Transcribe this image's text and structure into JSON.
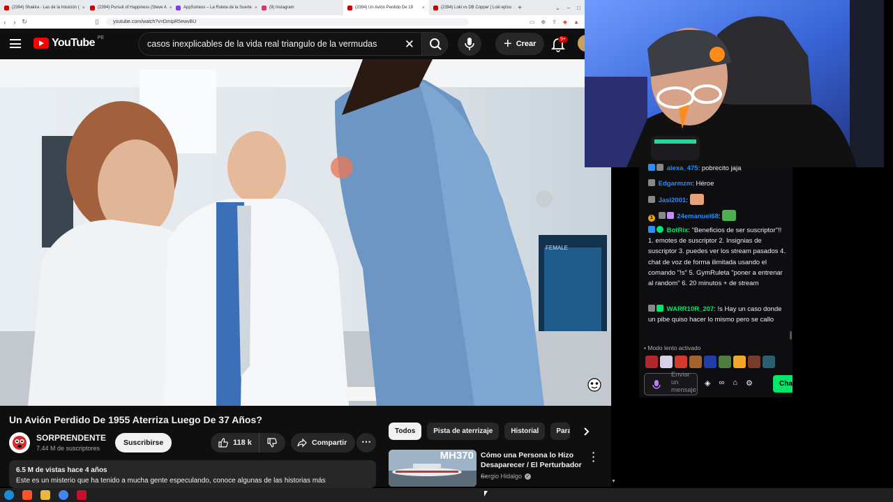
{
  "browser": {
    "tabs": [
      {
        "label": "(2394) Shakira - Las de la Intuición (",
        "color": "#cc0000",
        "active": false
      },
      {
        "label": "(2394) Pursuit of Happiness (Steve A",
        "color": "#cc0000",
        "active": false
      },
      {
        "label": "AppSorteos – La Ruleta de la Suerte",
        "color": "#7b3fe4",
        "active": false
      },
      {
        "label": "(9) Instagram",
        "color": "#e1306c",
        "active": false
      },
      {
        "label": "(2394) Un Avión Perdido De 19",
        "color": "#cc0000",
        "active": true
      },
      {
        "label": "(2394) Loki vs DB Copper | Loki episo",
        "color": "#cc0000",
        "active": false
      }
    ],
    "new_tab": "+",
    "url": "youtube.com/watch?v=DmipR5ewvBU"
  },
  "header": {
    "logo_text": "YouTube",
    "region": "PE",
    "search_query": "casos inexplicables de la vida real triangulo de la vermudas",
    "create_label": "Crear",
    "notif_count": "9+"
  },
  "video": {
    "title": "Un Avión Perdido De 1955 Aterriza Luego De 37 Años?",
    "channel_name": "SORPRENDENTE",
    "subscribers": "7.44 M de suscriptores",
    "subscribe_label": "Suscribirse",
    "likes": "118 k",
    "share_label": "Compartir",
    "stats": "6.5 M de vistas  hace 4 años",
    "description": "Este es un misterio que ha tenido a mucha gente especulando, conoce algunas de las historias más",
    "monitor_label": "FEMALE"
  },
  "chips": [
    "Todos",
    "Pista de aterrizaje",
    "Historial",
    "Para t"
  ],
  "recommended": {
    "thumb_text": "MH370",
    "title": "Cómo una Persona lo Hizo Desaparecer / El Perturbador ...",
    "channel": "Sergio Hidalgo"
  },
  "chat": {
    "messages": [
      {
        "user": "alexa_475",
        "user_color": "#1e90ff",
        "text": "pobrecito jaja"
      },
      {
        "user": "Edgarmzm",
        "user_color": "#1e90ff",
        "text": "Héroe"
      },
      {
        "user": "Jasl2001",
        "user_color": "#1e90ff",
        "text": ""
      },
      {
        "user": "24emanuel68",
        "user_color": "#1e90ff",
        "text": "",
        "badge_num": "1"
      },
      {
        "user": "BotRix",
        "user_color": "#00e66b",
        "text": "\"Beneficios de ser suscriptor\"!! 1. emotes de suscriptor 2. Insignias de suscriptor 3. puedes ver los stream pasados 4. chat de voz de forma ilimitada usando el comando \"!s\" 5. GymRuleta \"poner a entrenar al random\" 6. 20 minutos + de stream"
      },
      {
        "user": "WARR10R_207",
        "user_color": "#00e66b",
        "text": "!s Hay un caso donde un pibe quiso hacer lo mismo pero se callo"
      }
    ],
    "slow_mode": "Modo lento activado",
    "input_placeholder": "Enviar un mensaje",
    "send_label": "Chat"
  }
}
